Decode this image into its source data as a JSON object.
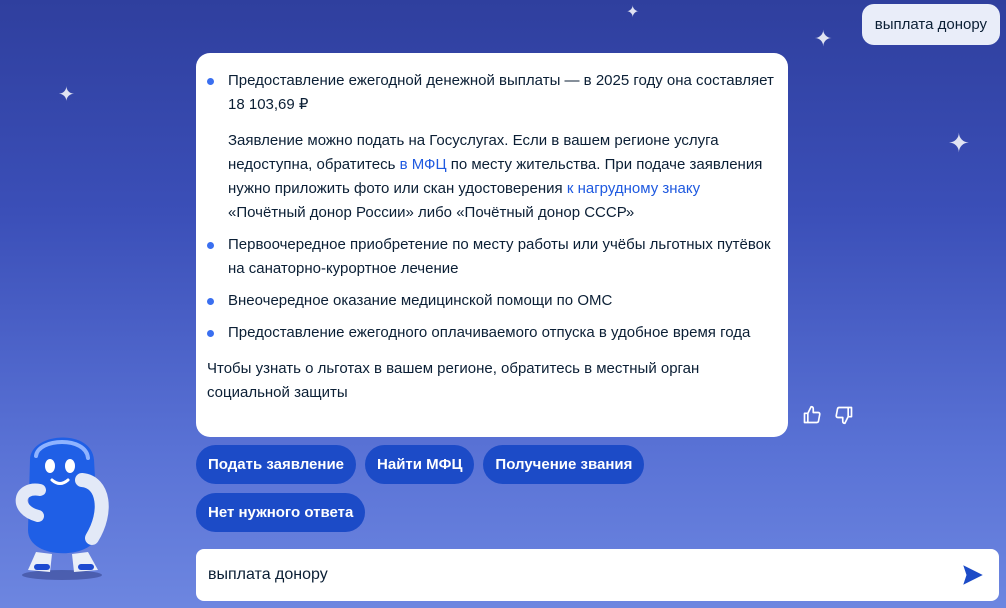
{
  "user_message": "выплата донору",
  "answer": {
    "bullet1_text": "Предоставление ежегодной денежной выплаты — в 2025 году она составляет 18 103,69 ₽",
    "paragraph": {
      "part1": "Заявление можно подать на Госуслугах. Если в вашем регионе услуга недоступна, обратитесь ",
      "link1": "в МФЦ",
      "part2": " по месту жительства. При подаче заявления нужно приложить фото или скан удостоверения ",
      "link2": "к нагрудному знаку",
      "part3": " «Почётный донор России» либо «Почётный донор СССР»"
    },
    "bullet2_text": "Первоочередное приобретение по месту работы или учёбы льготных путёвок на санаторно-курортное лечение",
    "bullet3_text": "Внеочередное оказание медицинской помощи по ОМС",
    "bullet4_text": "Предоставление ежегодного оплачиваемого отпуска в удобное время года",
    "footer": "Чтобы узнать о льготах в вашем регионе, обратитесь в местный орган социальной защиты"
  },
  "chips": {
    "submit": "Подать заявление",
    "find_mfc": "Найти МФЦ",
    "get_title": "Получение звания",
    "no_answer": "Нет нужного ответа"
  },
  "input": {
    "value": "выплата донору"
  },
  "icons": {
    "like": "thumbs-up-icon",
    "dislike": "thumbs-down-icon",
    "send": "send-icon",
    "mascot": "robot-mascot"
  },
  "colors": {
    "chip": "#1c4bc7",
    "link": "#1f5ae0",
    "bullet": "#3a6ff0"
  }
}
